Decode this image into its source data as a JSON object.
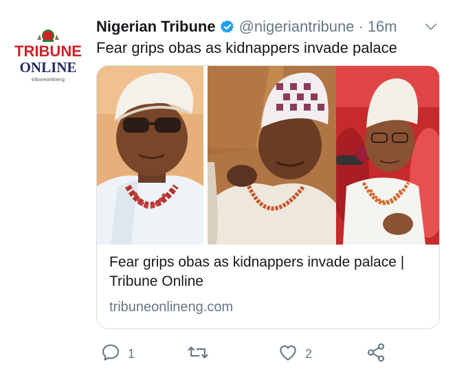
{
  "tweet": {
    "author_name": "Nigerian Tribune",
    "handle": "@nigeriantribune",
    "separator": "·",
    "time": "16m",
    "text": "Fear grips obas as kidnappers invade palace",
    "verified": true
  },
  "avatar": {
    "logo_line1": "TRIBUNE",
    "logo_line2": "ONLINE",
    "logo_url": "tribuneonlineng"
  },
  "card": {
    "title": "Fear grips obas as kidnappers invade palace | Tribune Online",
    "domain": "tribuneonlineng.com"
  },
  "actions": {
    "reply": {
      "icon": "reply-icon",
      "count": "1"
    },
    "retweet": {
      "icon": "retweet-icon",
      "count": ""
    },
    "like": {
      "icon": "heart-icon",
      "count": "2"
    },
    "share": {
      "icon": "share-icon",
      "count": ""
    }
  },
  "colors": {
    "text": "#14171a",
    "secondary": "#657786",
    "verified": "#1da1f2",
    "border": "#d6dde3",
    "brand_red": "#d22027",
    "brand_navy": "#1f2a66"
  }
}
